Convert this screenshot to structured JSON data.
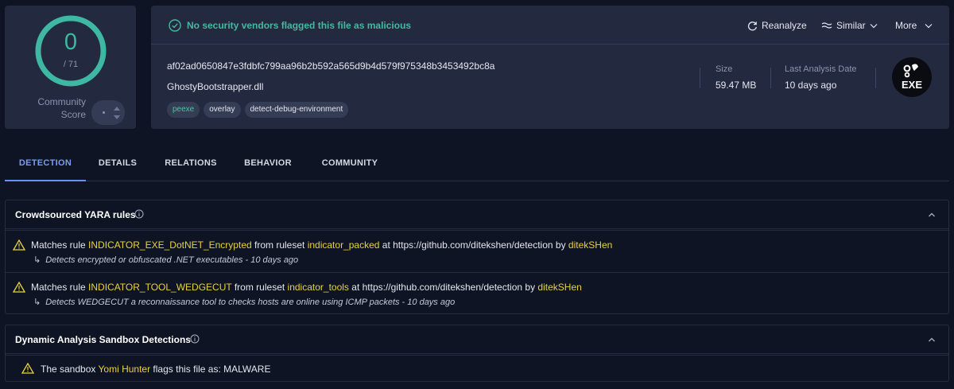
{
  "community": {
    "score": "0",
    "total": "/ 71",
    "label_line1": "Community",
    "label_line2": "Score"
  },
  "summary": {
    "status_text": "No security vendors flagged this file as malicious",
    "actions": {
      "reanalyze": "Reanalyze",
      "similar": "Similar",
      "more": "More"
    },
    "hash": "af02ad0650847e3fdbfc799aa96b2b592a565d9b4d579f975348b3453492bc8a",
    "filename": "GhostyBootstrapper.dll",
    "tags": [
      "peexe",
      "overlay",
      "detect-debug-environment"
    ],
    "size_label": "Size",
    "size_value": "59.47 MB",
    "last_analysis_label": "Last Analysis Date",
    "last_analysis_value": "10 days ago",
    "filetype_badge": "EXE"
  },
  "tabs": [
    "DETECTION",
    "DETAILS",
    "RELATIONS",
    "BEHAVIOR",
    "COMMUNITY"
  ],
  "yara": {
    "title": "Crowdsourced YARA rules",
    "rules": [
      {
        "prefix": "Matches rule ",
        "rule": "INDICATOR_EXE_DotNET_Encrypted",
        "mid": " from ruleset ",
        "ruleset": "indicator_packed",
        "at": " at https://github.com/ditekshen/detection by ",
        "author": "ditekSHen",
        "description": "Detects encrypted or obfuscated .NET executables - 10 days ago"
      },
      {
        "prefix": "Matches rule ",
        "rule": "INDICATOR_TOOL_WEDGECUT",
        "mid": " from ruleset ",
        "ruleset": "indicator_tools",
        "at": " at https://github.com/ditekshen/detection by ",
        "author": "ditekSHen",
        "description": "Detects WEDGECUT a reconnaissance tool to checks hosts are online using ICMP packets - 10 days ago"
      }
    ]
  },
  "sandbox": {
    "title": "Dynamic Analysis Sandbox Detections",
    "prefix": "The sandbox ",
    "sandbox_name": "Yomi Hunter",
    "suffix": " flags this file as: MALWARE"
  },
  "colors": {
    "background": "#0f1424",
    "card": "#232a40",
    "clean_green": "#45b89f",
    "highlight_yellow": "#e7d33b",
    "tab_active": "#7b9cf2"
  },
  "icons": [
    "check-circle-icon",
    "refresh-icon",
    "similar-icon",
    "chevron-down-icon",
    "info-icon",
    "chevron-up-icon",
    "warning-icon",
    "exe-file-icon"
  ]
}
